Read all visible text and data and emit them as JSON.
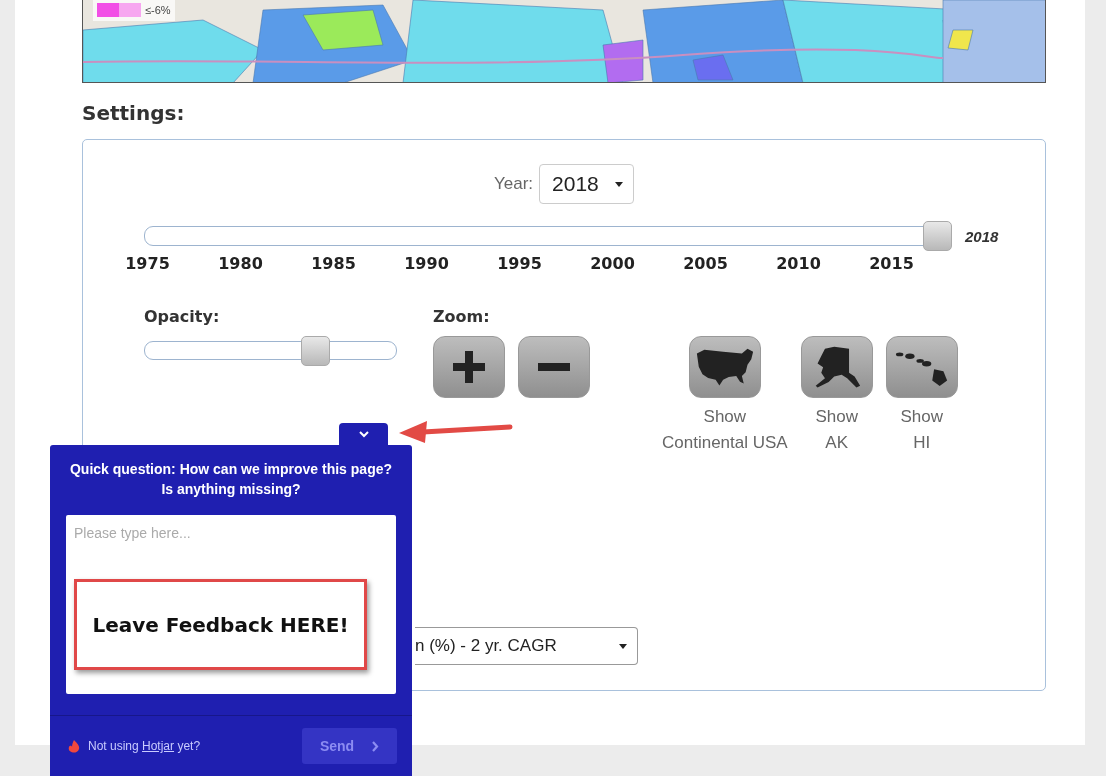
{
  "map": {
    "kind": "picture",
    "legend": [
      {
        "color": "#f24fe6"
      },
      {
        "color": "#f7a6f0"
      }
    ],
    "legend_label": "≤-6%"
  },
  "settings_title": "Settings:",
  "year": {
    "label": "Year:",
    "value": "2018"
  },
  "year_slider": {
    "level": 1,
    "reading": "2018",
    "ticks": [
      "1975",
      "1980",
      "1985",
      "1990",
      "1995",
      "2000",
      "2005",
      "2010",
      "2015"
    ]
  },
  "opacity": {
    "label": "Opacity:",
    "level": 0.7
  },
  "zoom": {
    "label": "Zoom:",
    "buttons": [
      {
        "kind": "in"
      },
      {
        "kind": "out"
      }
    ]
  },
  "region_buttons": [
    {
      "kind": "usa",
      "lines": [
        "Show",
        "Continental USA"
      ]
    },
    {
      "kind": "ak",
      "lines": [
        "Show",
        "AK"
      ]
    },
    {
      "kind": "hi",
      "lines": [
        "Show",
        "HI"
      ]
    }
  ],
  "metric_select": {
    "value": "n (%) - 2 yr. CAGR"
  },
  "feedback": {
    "question": "Quick question: How can we improve this page? Is anything missing?",
    "placeholder": "Please type here...",
    "annotation": "Leave Feedback HERE!",
    "footer_before": "Not using ",
    "footer_link": "Hotjar",
    "footer_after": " yet?",
    "send": "Send",
    "send_disabled": true
  }
}
